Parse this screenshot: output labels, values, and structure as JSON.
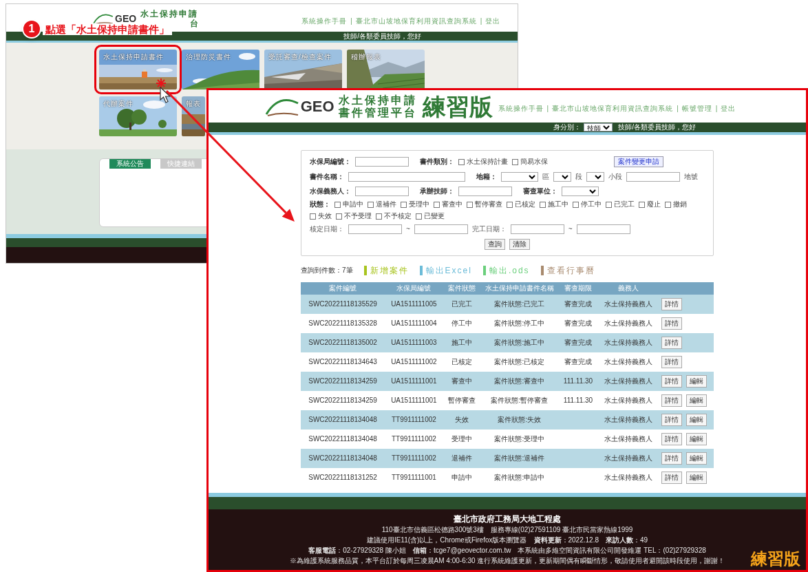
{
  "background_window": {
    "logo": {
      "brand": "GEO",
      "line1": "水土保持申請",
      "line2": "台"
    },
    "header_links": {
      "items": [
        "系統操作手冊",
        "臺北市山坡地保育利用資訊查詢系統",
        "登出"
      ],
      "separator": "|"
    },
    "greeting": "技師/各類委員技師，您好",
    "tiles": [
      {
        "label": "水土保持申請書件",
        "selected": true
      },
      {
        "label": "治理防災書件",
        "selected": false
      },
      {
        "label": "受託審查/檢查案件",
        "selected": false
      },
      {
        "label": "稽辦報表",
        "selected": false
      },
      {
        "label": "代辦案件",
        "selected": false
      },
      {
        "label": "報表",
        "selected": false
      }
    ],
    "notice_tabs": [
      {
        "label": "系統公告",
        "selected": true
      },
      {
        "label": "快捷連結",
        "selected": false
      }
    ]
  },
  "callout": {
    "number": "1",
    "text": "點選「水土保持申請書件」"
  },
  "window": {
    "logo": {
      "brand": "GEO",
      "line1": "水土保持申請",
      "line2": "書件管理平台",
      "edition": "練習版"
    },
    "header_links": {
      "items": [
        "系統操作手冊",
        "臺北市山坡地保育利用資訊查詢系統",
        "帳號管理",
        "登出"
      ],
      "separator": "|"
    },
    "identity": {
      "label": "身分別：",
      "value": "技師"
    },
    "greeting": "技師/各類委員技師，您好",
    "search_form": {
      "rows": [
        {
          "items": [
            {
              "kind": "label",
              "text": "水保局編號："
            },
            {
              "kind": "input"
            },
            {
              "kind": "label",
              "text": "書件類別："
            },
            {
              "kind": "checkbox",
              "label": "水土保持計畫",
              "checked": false
            },
            {
              "kind": "checkbox",
              "label": "簡易水保",
              "checked": false
            },
            {
              "kind": "link_button",
              "text": "案件變更申請"
            }
          ]
        },
        {
          "items": [
            {
              "kind": "label",
              "text": "書件名稱："
            },
            {
              "kind": "long_input"
            },
            {
              "kind": "label",
              "text": "地籍："
            },
            {
              "kind": "select"
            },
            {
              "kind": "text",
              "text": "區"
            },
            {
              "kind": "small_select"
            },
            {
              "kind": "text",
              "text": "段"
            },
            {
              "kind": "small_select"
            },
            {
              "kind": "text",
              "text": "小段"
            },
            {
              "kind": "input"
            },
            {
              "kind": "text",
              "text": "地號"
            }
          ]
        },
        {
          "items": [
            {
              "kind": "label",
              "text": "水保義務人："
            },
            {
              "kind": "input"
            },
            {
              "kind": "label",
              "text": "承辦技師："
            },
            {
              "kind": "input"
            },
            {
              "kind": "label",
              "text": "審查單位："
            },
            {
              "kind": "select"
            }
          ]
        },
        {
          "items": [
            {
              "kind": "label",
              "text": "狀態："
            },
            {
              "kind": "checkbox",
              "label": "申請中",
              "checked": false
            },
            {
              "kind": "checkbox",
              "label": "退補件",
              "checked": false
            },
            {
              "kind": "checkbox",
              "label": "受理中",
              "checked": false
            },
            {
              "kind": "checkbox",
              "label": "審查中",
              "checked": false
            },
            {
              "kind": "checkbox",
              "label": "暫停審查",
              "checked": false
            },
            {
              "kind": "checkbox",
              "label": "已核定",
              "checked": false
            },
            {
              "kind": "checkbox",
              "label": "施工中",
              "checked": false
            },
            {
              "kind": "checkbox",
              "label": "停工中",
              "checked": false
            },
            {
              "kind": "checkbox",
              "label": "已完工",
              "checked": false
            },
            {
              "kind": "checkbox",
              "label": "廢止",
              "checked": false
            },
            {
              "kind": "checkbox",
              "label": "撤銷",
              "checked": false
            },
            {
              "kind": "checkbox",
              "label": "失效",
              "checked": false
            },
            {
              "kind": "checkbox",
              "label": "不予受理",
              "checked": false
            },
            {
              "kind": "checkbox",
              "label": "不予核定",
              "checked": false
            },
            {
              "kind": "checkbox",
              "label": "已變更",
              "checked": false
            }
          ]
        },
        {
          "items": [
            {
              "kind": "text",
              "text": "核定日期："
            },
            {
              "kind": "input"
            },
            {
              "kind": "text",
              "text": "~"
            },
            {
              "kind": "input"
            },
            {
              "kind": "text",
              "text": "完工日期："
            },
            {
              "kind": "input"
            },
            {
              "kind": "text",
              "text": "~"
            },
            {
              "kind": "input"
            }
          ]
        },
        {
          "items": [
            {
              "kind": "button",
              "text": "查詢"
            },
            {
              "kind": "button",
              "text": "清除"
            }
          ]
        }
      ]
    },
    "results": {
      "count": "查詢到件數：7筆",
      "actions": [
        {
          "label": "新增案件",
          "color": "#a8c41e"
        },
        {
          "label": "輸出Excel",
          "color": "#6cbcd8"
        },
        {
          "label": "輸出.ods",
          "color": "#6bcf7c"
        },
        {
          "label": "查看行事曆",
          "color": "#a88a6e"
        }
      ]
    },
    "table": {
      "columns": [
        "案件編號",
        "水保局編號",
        "案件狀態",
        "水土保持申請書件名稱",
        "審查期限",
        "義務人"
      ],
      "rows": [
        {
          "case_no": "SWC20221118135529",
          "swcb_no": "UA1511111005",
          "status": "已完工",
          "name": "案件狀態:已完工",
          "deadline": "審查完成",
          "obligor": "水土保持義務人",
          "buttons": [
            "詳情"
          ]
        },
        {
          "case_no": "SWC20221118135328",
          "swcb_no": "UA1511111004",
          "status": "停工中",
          "name": "案件狀態:停工中",
          "deadline": "審查完成",
          "obligor": "水土保持義務人",
          "buttons": [
            "詳情"
          ]
        },
        {
          "case_no": "SWC20221118135002",
          "swcb_no": "UA1511111003",
          "status": "施工中",
          "name": "案件狀態:施工中",
          "deadline": "審查完成",
          "obligor": "水土保持義務人",
          "buttons": [
            "詳情"
          ]
        },
        {
          "case_no": "SWC20221118134643",
          "swcb_no": "UA1511111002",
          "status": "已核定",
          "name": "案件狀態:已核定",
          "deadline": "審查完成",
          "obligor": "水土保持義務人",
          "buttons": [
            "詳情"
          ]
        },
        {
          "case_no": "SWC20221118134259",
          "swcb_no": "UA1511111001",
          "status": "審查中",
          "name": "案件狀態:審查中",
          "deadline": "111.11.30",
          "obligor": "水土保持義務人",
          "buttons": [
            "詳情",
            "編輯"
          ]
        },
        {
          "case_no": "SWC20221118134259",
          "swcb_no": "UA1511111001",
          "status": "暫停審查",
          "name": "案件狀態:暫停審查",
          "deadline": "111.11.30",
          "obligor": "水土保持義務人",
          "buttons": [
            "詳情",
            "編輯"
          ]
        },
        {
          "case_no": "SWC20221118134048",
          "swcb_no": "TT9911111002",
          "status": "失效",
          "name": "案件狀態:失效",
          "obligor": "水土保持義務人",
          "buttons": [
            "詳情",
            "編輯"
          ]
        },
        {
          "case_no": "SWC20221118134048",
          "swcb_no": "TT9911111002",
          "status": "受理中",
          "name": "案件狀態:受理中",
          "obligor": "水土保持義務人",
          "buttons": [
            "詳情",
            "編輯"
          ]
        },
        {
          "case_no": "SWC20221118134048",
          "swcb_no": "TT9911111002",
          "status": "退補件",
          "name": "案件狀態:退補件",
          "obligor": "水土保持義務人",
          "buttons": [
            "詳情",
            "編輯"
          ]
        },
        {
          "case_no": "SWC20221118131252",
          "swcb_no": "TT9911111001",
          "status": "申請中",
          "name": "案件狀態:申請中",
          "obligor": "水土保持義務人",
          "buttons": [
            "詳情",
            "編輯"
          ]
        }
      ]
    },
    "footer": {
      "title": "臺北市政府工務局大地工程處",
      "lines": [
        "110臺北市信義區松德路300號3樓　服務專線(02)27591109 臺北市民當家熱線1999",
        "建議使用IE11(含)以上，Chrome或Firefox版本瀏覽器　**資料更新**：2022.12.8　**來訪人數**：49",
        "**客服電話**：02-27929328 陳小姐　**信箱**：tcge7@geovector.com.tw　本系統由多維空間資訊有限公司開發維運 TEL：(02)27929328",
        "※為維護系統服務品質，本平台訂於每周三凌晨AM 4:00-6:30 進行系統維護更新，更新期間偶有瞬斷情形，敬請使用者避開該時段使用，謝謝！"
      ],
      "edition_badge": "練習版"
    }
  }
}
